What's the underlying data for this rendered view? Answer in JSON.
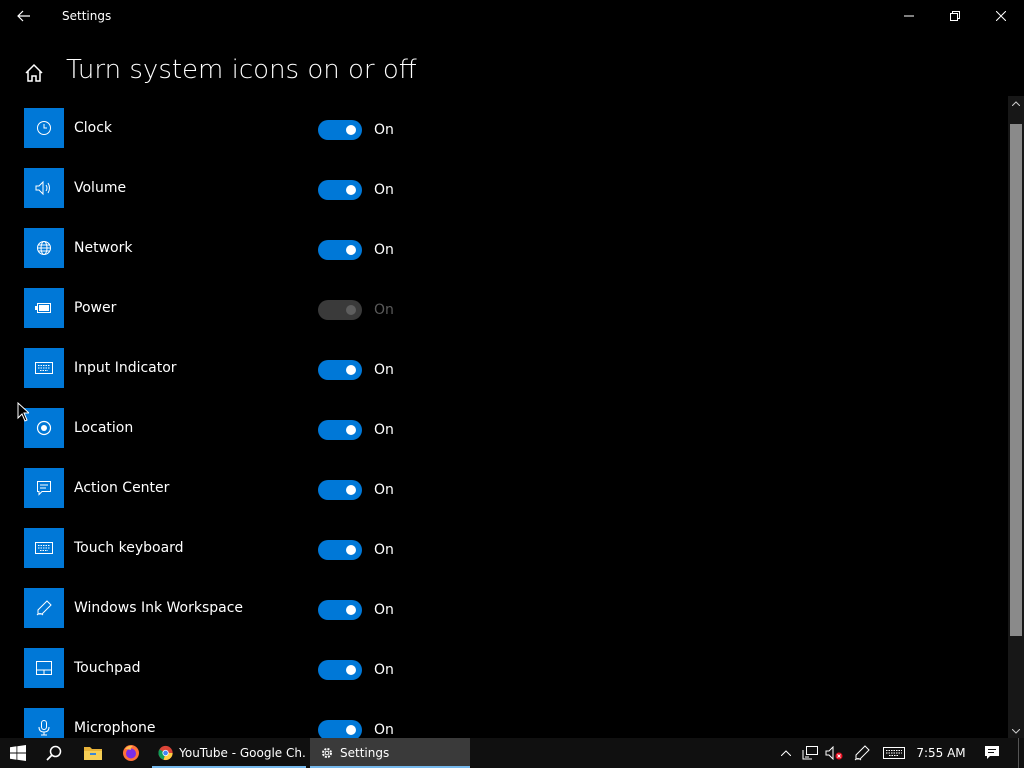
{
  "window": {
    "title": "Settings",
    "controls": [
      "minimize",
      "maximize",
      "close"
    ]
  },
  "page": {
    "title": "Turn system icons on or off"
  },
  "items": [
    {
      "label": "Clock",
      "state": "On",
      "enabled": true,
      "icon": "clock-icon"
    },
    {
      "label": "Volume",
      "state": "On",
      "enabled": true,
      "icon": "volume-icon"
    },
    {
      "label": "Network",
      "state": "On",
      "enabled": true,
      "icon": "network-globe-icon"
    },
    {
      "label": "Power",
      "state": "On",
      "enabled": false,
      "icon": "battery-icon"
    },
    {
      "label": "Input Indicator",
      "state": "On",
      "enabled": true,
      "icon": "keyboard-icon"
    },
    {
      "label": "Location",
      "state": "On",
      "enabled": true,
      "icon": "location-target-icon"
    },
    {
      "label": "Action Center",
      "state": "On",
      "enabled": true,
      "icon": "action-center-icon"
    },
    {
      "label": "Touch keyboard",
      "state": "On",
      "enabled": true,
      "icon": "touch-keyboard-icon"
    },
    {
      "label": "Windows Ink Workspace",
      "state": "On",
      "enabled": true,
      "icon": "pen-icon"
    },
    {
      "label": "Touchpad",
      "state": "On",
      "enabled": true,
      "icon": "touchpad-icon"
    },
    {
      "label": "Microphone",
      "state": "On",
      "enabled": true,
      "icon": "microphone-icon"
    }
  ],
  "taskbar": {
    "apps": [
      {
        "label": "YouTube - Google Ch...",
        "icon": "chrome-icon"
      },
      {
        "label": "Settings",
        "icon": "gear-icon",
        "active": true
      }
    ],
    "clock": "7:55 AM"
  },
  "colors": {
    "accent": "#0078d7",
    "background": "#000000",
    "taskbar": "#101010",
    "disabled_toggle": "#3a3a3a",
    "active_task_underline": "#76b9ed"
  }
}
